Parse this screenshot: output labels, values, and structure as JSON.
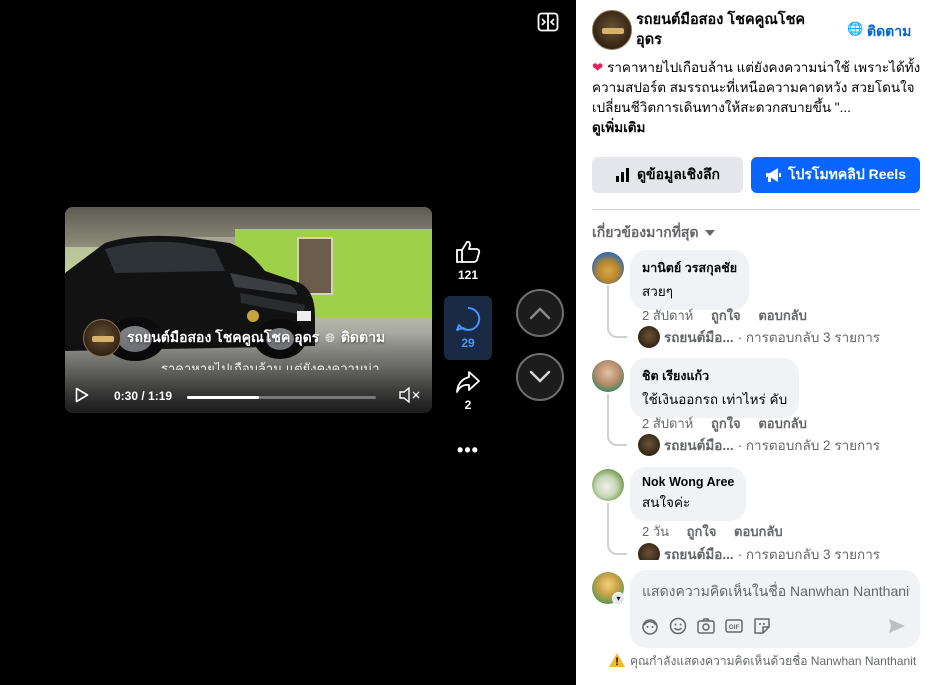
{
  "video": {
    "page_name": "รถยนต์มือสอง โชคคูณโชค อุดร",
    "follow_label": "ติดตาม",
    "time": "0:30 / 1:19",
    "progress": 0.38,
    "actions": {
      "likes": "121",
      "comments": "29",
      "shares": "2",
      "more": "•••"
    }
  },
  "panel": {
    "page_name": "รถยนต์มือสอง โชคคูณโชค อุดร",
    "follow_label": "ติดตาม",
    "globe_symbol": "🌐 ·",
    "heart": "❤",
    "post_text": "ราคาหายไปเกือบล้าน แต่ยังคงความน่าใช้ เพราะได้ทั้งความสปอร์ต สมรรถนะที่เหนือความคาดหวัง สวยโดนใจ เปลี่ยนชีวิตการเดินทางให้สะดวกสบายขึ้น \"...",
    "see_more": "ดูเพิ่มเติม",
    "insight_button": "ดูข้อมูลเชิงลึก",
    "promote_button": "โปรโมทคลิป Reels",
    "sort_label": "เกี่ยวข้องมากที่สุด",
    "comments": [
      {
        "author": "มานิตย์ วรสกุลชัย",
        "text": "สวยๆ",
        "time": "2 สัปดาห์",
        "like": "ถูกใจ",
        "reply": "ตอบกลับ",
        "reply_page": "รถยนต์มือ...",
        "reply_count": "· การตอบกลับ 3 รายการ"
      },
      {
        "author": "ชิต เรียงแก้ว",
        "text": "ใช้เงินออกรถ เท่าไหร่ คับ",
        "time": "2 สัปดาห์",
        "like": "ถูกใจ",
        "reply": "ตอบกลับ",
        "reply_page": "รถยนต์มือ...",
        "reply_count": "· การตอบกลับ 2 รายการ"
      },
      {
        "author": "Nok Wong Aree",
        "text": "สนใจค่ะ",
        "time": "2 วัน",
        "like": "ถูกใจ",
        "reply": "ตอบกลับ",
        "reply_page": "รถยนต์มือ...",
        "reply_count": "· การตอบกลับ 3 รายการ"
      }
    ],
    "composer_placeholder": "แสดงความคิดเห็นในชื่อ Nanwhan Nanthanit",
    "notice": "คุณกำลังแสดงความคิดเห็นด้วยชื่อ Nanwhan Nanthanit"
  },
  "colors": {
    "accent": "#0866ff",
    "follow_link": "#0064d1",
    "comment_count": "#4599ff",
    "bubble": "#f0f2f5"
  },
  "icons": [
    "pip-icon",
    "play-icon",
    "mute-icon",
    "like-icon",
    "comment-icon",
    "share-icon",
    "more-icon",
    "chevron-up-icon",
    "chevron-down-icon",
    "globe-icon",
    "insight-icon",
    "megaphone-icon",
    "caret-down-icon",
    "avatar-icon",
    "emoji-icon",
    "camera-icon",
    "gif-icon",
    "sticker-icon",
    "send-icon",
    "warning-icon"
  ]
}
